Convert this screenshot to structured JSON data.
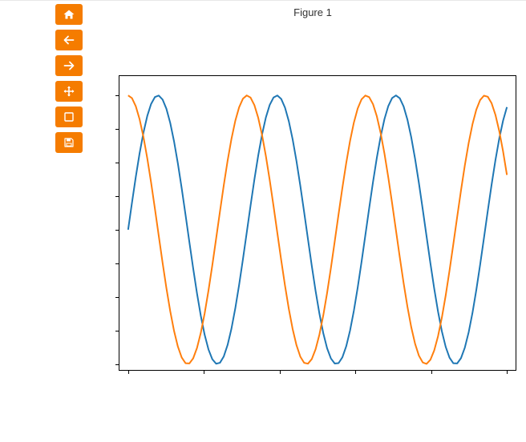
{
  "figure": {
    "title": "Figure 1"
  },
  "toolbar": {
    "buttons": [
      {
        "name": "home",
        "icon": "home-icon"
      },
      {
        "name": "back",
        "icon": "arrow-left-icon"
      },
      {
        "name": "forward",
        "icon": "arrow-right-icon"
      },
      {
        "name": "pan",
        "icon": "move-icon"
      },
      {
        "name": "zoom",
        "icon": "square-icon"
      },
      {
        "name": "save",
        "icon": "floppy-disk-icon"
      }
    ],
    "button_color": "#f57c00",
    "icon_color": "#ffffff"
  },
  "chart_data": {
    "type": "line",
    "title": "",
    "xlabel": "",
    "ylabel": "",
    "xlim": [
      -0.5,
      20.5
    ],
    "ylim": [
      -1.05,
      1.15
    ],
    "x_ticks": [
      0,
      4,
      8,
      12,
      16,
      20
    ],
    "y_ticks": [
      -1.0,
      -0.75,
      -0.5,
      -0.25,
      0.0,
      0.25,
      0.5,
      0.75,
      1.0
    ],
    "tick_labels_visible": false,
    "grid": false,
    "legend": "none",
    "series": [
      {
        "color": "#1f77b4",
        "function": "sin",
        "x_start": 0,
        "x_end": 20,
        "samples": 100
      },
      {
        "color": "#ff7f0e",
        "function": "cos",
        "x_start": 0,
        "x_end": 20,
        "samples": 100
      }
    ]
  }
}
